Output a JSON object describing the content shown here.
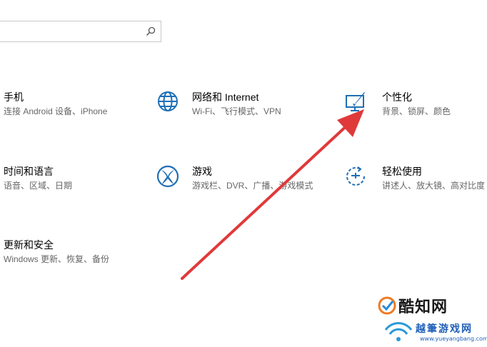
{
  "search": {
    "placeholder": ""
  },
  "settings": [
    {
      "title": "手机",
      "desc": "连接 Android 设备、iPhone"
    },
    {
      "title": "网络和 Internet",
      "desc": "Wi-Fi、飞行模式、VPN"
    },
    {
      "title": "个性化",
      "desc": "背景、锁屏、颜色"
    },
    {
      "title": "时间和语言",
      "desc": "语音、区域、日期"
    },
    {
      "title": "游戏",
      "desc": "游戏栏、DVR、广播、游戏模式"
    },
    {
      "title": "轻松使用",
      "desc": "讲述人、放大镜、高对比度"
    },
    {
      "title": "更新和安全",
      "desc": "Windows 更新、恢复、备份"
    }
  ],
  "watermark": {
    "brand": "酷知网",
    "site": "越筆游戏网",
    "url": "www.yueyangbang.com"
  },
  "colors": {
    "icon": "#1f6fb5",
    "arrow": "#e0393a"
  }
}
